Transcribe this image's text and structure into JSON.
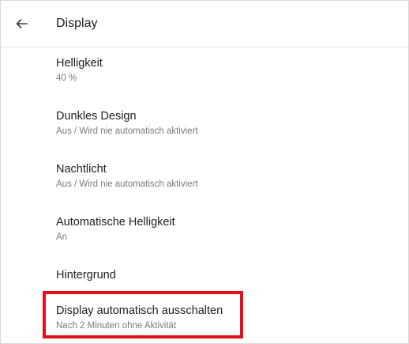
{
  "header": {
    "title": "Display",
    "back_icon": "arrow-back-icon"
  },
  "settings": [
    {
      "title": "Helligkeit",
      "summary": "40 %"
    },
    {
      "title": "Dunkles Design",
      "summary": "Aus / Wird nie automatisch aktiviert"
    },
    {
      "title": "Nachtlicht",
      "summary": "Aus / Wird nie automatisch aktiviert"
    },
    {
      "title": "Automatische Helligkeit",
      "summary": "An"
    },
    {
      "title": "Hintergrund",
      "summary": ""
    },
    {
      "title": "Display automatisch ausschalten",
      "summary": "Nach 2 Minuten ohne Aktivität"
    }
  ],
  "highlight_color": "#e3101b"
}
